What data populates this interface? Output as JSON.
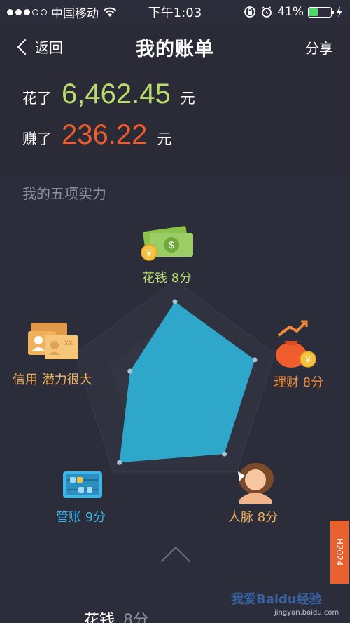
{
  "status_bar": {
    "carrier": "中国移动",
    "time": "下午1:03",
    "battery": "41%",
    "battery_level": 0.41,
    "signal_bars_filled": 3
  },
  "nav": {
    "back_label": "返回",
    "title": "我的账单",
    "share_label": "分享"
  },
  "summary": {
    "spent_label": "花了",
    "spent_amount": "6,462.45",
    "spent_unit": "元",
    "earned_label": "赚了",
    "earned_amount": "236.22",
    "earned_unit": "元"
  },
  "section_title": "我的五项实力",
  "radar": {
    "spend": "花钱 8分",
    "invest": "理财 8分",
    "network": "人脉 8分",
    "account": "管账 9分",
    "credit": "信用 潜力很大"
  },
  "radar_values": {
    "axes": [
      "spend",
      "invest",
      "network",
      "account",
      "credit"
    ],
    "fractions": [
      0.8,
      0.8,
      0.8,
      0.9,
      0.45
    ]
  },
  "bottom": {
    "title": "花钱",
    "score": "8分"
  },
  "ribbon_text": "H2024",
  "watermark": {
    "main": "我爱Baidu经验",
    "sub": "jingyan.baidu.com"
  },
  "colors": {
    "background": "#2b2d3a",
    "spend": "#b9dd6b",
    "earned": "#ef5d2c",
    "radar_fill": "#2ea7cb",
    "account": "#3fb4e8"
  }
}
